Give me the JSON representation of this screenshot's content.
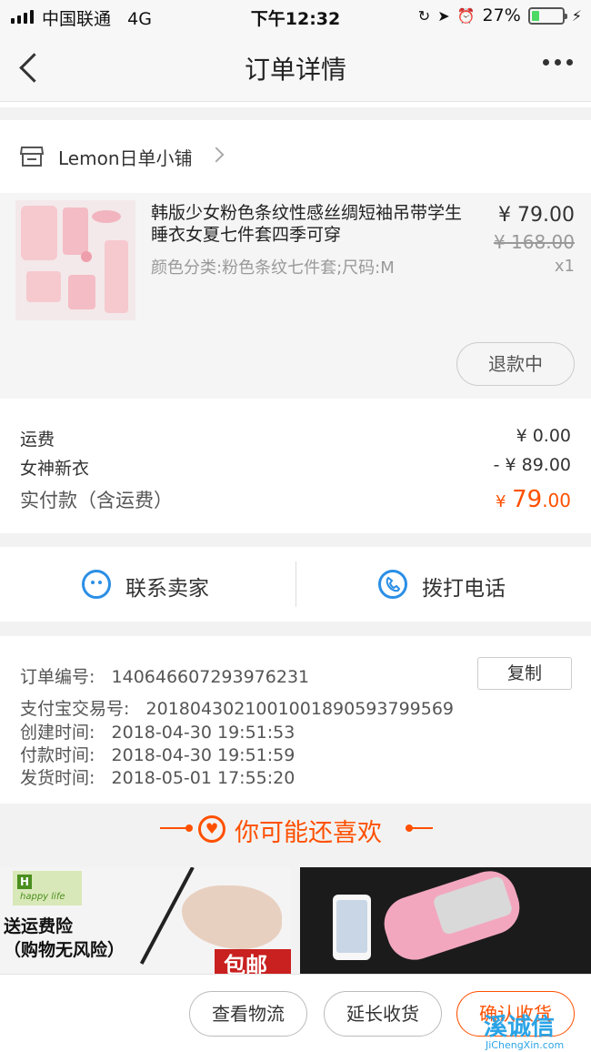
{
  "status": {
    "carrier": "中国联通",
    "network": "4G",
    "time": "下午12:32",
    "battery_text": "27%",
    "battery_level": 0.27,
    "icons": [
      "lock-rotation-icon",
      "location-icon",
      "alarm-icon",
      "charging-icon"
    ]
  },
  "nav": {
    "title": "订单详情",
    "back_icon": "chevron-left-icon",
    "more_icon": "more-dots-icon"
  },
  "shop": {
    "name": "Lemon日单小铺",
    "icon": "store-icon"
  },
  "item": {
    "title": "韩版少女粉色条纹性感丝绸短袖吊带学生睡衣女夏七件套四季可穿",
    "sku": "颜色分类:粉色条纹七件套;尺码:M",
    "price": "¥ 79.00",
    "original_price": "¥ 168.00",
    "quantity": "x1",
    "refund_label": "退款中"
  },
  "fees": {
    "shipping_label": "运费",
    "shipping_value": "¥ 0.00",
    "discount_label": "女神新衣",
    "discount_value": "- ¥ 89.00",
    "total_label": "实付款（含运费）",
    "total_currency": "¥",
    "total_integer": "79",
    "total_decimal": ".00",
    "accent_color": "#ff5000"
  },
  "contact": {
    "seller_label": "联系卖家",
    "seller_icon": "chat-bubble-icon",
    "phone_label": "拨打电话",
    "phone_icon": "phone-icon",
    "icon_color": "#2b8fe6"
  },
  "order": {
    "number_label": "订单编号:",
    "number_value": "140646607293976231",
    "copy_label": "复制",
    "alipay_label": "支付宝交易号:",
    "alipay_value": "2018043021001001890593799569",
    "created_label": "创建时间:",
    "created_value": "2018-04-30 19:51:53",
    "paid_label": "付款时间:",
    "paid_value": "2018-04-30 19:51:59",
    "shipped_label": "发货时间:",
    "shipped_value": "2018-05-01 17:55:20"
  },
  "recommend": {
    "title": "你可能还喜欢",
    "icon": "heart-icon",
    "product1_brand": "happy life",
    "product1_text_1": "送运费险",
    "product1_text_2": "（购物无风险）",
    "product1_banner": "包邮"
  },
  "bottom": {
    "logistics_label": "查看物流",
    "extend_label": "延长收货",
    "confirm_label": "确认收货"
  },
  "watermark": {
    "logo": "溪诚信",
    "url": "JiChengXin.com"
  }
}
